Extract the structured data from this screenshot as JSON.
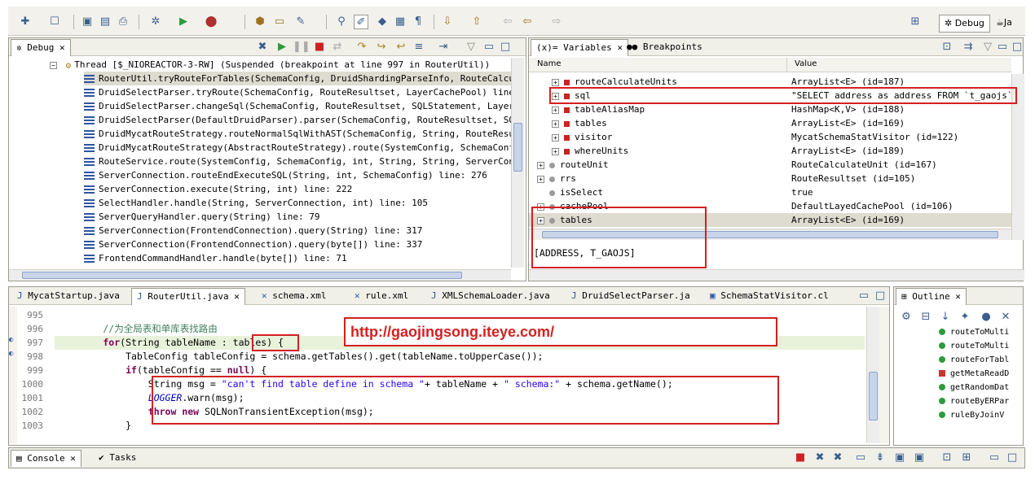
{
  "perspectives": {
    "debug": "Debug",
    "java": "Ja"
  },
  "debug_view": {
    "tab": "Debug",
    "thread": "Thread [$_NIOREACTOR-3-RW] (Suspended (breakpoint at line 997 in RouterUtil))",
    "frames": [
      "RouterUtil.tryRouteForTables(SchemaConfig, DruidShardingParseInfo, RouteCalculateUnit,",
      "DruidSelectParser.tryRoute(SchemaConfig, RouteResultset, LayerCachePool) line: 412",
      "DruidSelectParser.changeSql(SchemaConfig, RouteResultset, SQLStatement, LayerCachePool",
      "DruidSelectParser(DefaultDruidParser).parser(SchemaConfig, RouteResultset, SQLStatemen",
      "DruidMycatRouteStrategy.routeNormalSqlWithAST(SchemaConfig, String, RouteResultset, St",
      "DruidMycatRouteStrategy(AbstractRouteStrategy).route(SystemConfig, SchemaConfig, int,",
      "RouteService.route(SystemConfig, SchemaConfig, int, String, String, ServerConnection)",
      "ServerConnection.routeEndExecuteSQL(String, int, SchemaConfig) line: 276",
      "ServerConnection.execute(String, int) line: 222",
      "SelectHandler.handle(String, ServerConnection, int) line: 105",
      "ServerQueryHandler.query(String) line: 79",
      "ServerConnection(FrontendConnection).query(String) line: 317",
      "ServerConnection(FrontendConnection).query(byte[]) line: 337",
      "FrontendCommandHandler.handle(byte[]) line: 71"
    ]
  },
  "variables_view": {
    "tabs": [
      "Variables",
      "Breakpoints"
    ],
    "col_name": "Name",
    "col_value": "Value",
    "rows": [
      {
        "name": "routeCalculateUnits",
        "value": "ArrayList<E>  (id=187)",
        "kind": "field"
      },
      {
        "name": "sql",
        "value": "\"SELECT address as address  FROM `t_gaojs`\" (id",
        "kind": "field"
      },
      {
        "name": "tableAliasMap",
        "value": "HashMap<K,V>  (id=188)",
        "kind": "field"
      },
      {
        "name": "tables",
        "value": "ArrayList<E>  (id=169)",
        "kind": "field"
      },
      {
        "name": "visitor",
        "value": "MycatSchemaStatVisitor  (id=122)",
        "kind": "field"
      },
      {
        "name": "whereUnits",
        "value": "ArrayList<E>  (id=189)",
        "kind": "field"
      },
      {
        "name": "routeUnit",
        "value": "RouteCalculateUnit  (id=167)",
        "kind": "local"
      },
      {
        "name": "rrs",
        "value": "RouteResultset  (id=105)",
        "kind": "local"
      },
      {
        "name": "isSelect",
        "value": "true",
        "kind": "local"
      },
      {
        "name": "cachePool",
        "value": "DefaultLayedCachePool  (id=106)",
        "kind": "local"
      },
      {
        "name": "tables",
        "value": "ArrayList<E>  (id=169)",
        "kind": "local"
      }
    ],
    "detail": "[ADDRESS, T_GAOJS]"
  },
  "editor": {
    "tabs": [
      "MycatStartup.java",
      "RouterUtil.java",
      "schema.xml",
      "rule.xml",
      "XMLSchemaLoader.java",
      "DruidSelectParser.ja",
      "SchemaStatVisitor.cl"
    ],
    "lines": [
      {
        "n": "995",
        "parts": [
          [
            "",
            ""
          ]
        ]
      },
      {
        "n": "996",
        "parts": [
          [
            "cmt",
            "        //为全局表和单库表找路由"
          ]
        ]
      },
      {
        "n": "997",
        "parts": [
          [
            "kw",
            "        for"
          ],
          [
            "",
            "(String tableName : "
          ],
          [
            "",
            "tables"
          ],
          [
            "",
            ") {"
          ]
        ]
      },
      {
        "n": "998",
        "parts": [
          [
            "",
            "            TableConfig tableConfig = schema.getTables().get(tableName.toUpperCase());"
          ]
        ]
      },
      {
        "n": "999",
        "parts": [
          [
            "kw",
            "            if"
          ],
          [
            "",
            "(tableConfig == "
          ],
          [
            "kw",
            "null"
          ],
          [
            "",
            ") {"
          ]
        ]
      },
      {
        "n": "1000",
        "parts": [
          [
            "",
            "                String msg = "
          ],
          [
            "str",
            "\"can't find table define in schema \""
          ],
          [
            "",
            "+ tableName + "
          ],
          [
            "str",
            "\" schema:\""
          ],
          [
            "",
            " + schema.getName();"
          ]
        ]
      },
      {
        "n": "1001",
        "parts": [
          [
            "fld",
            "                LOGGER"
          ],
          [
            "",
            ".warn(msg);"
          ]
        ]
      },
      {
        "n": "1002",
        "parts": [
          [
            "kw",
            "                throw new"
          ],
          [
            "",
            " SQLNonTransientException(msg);"
          ]
        ]
      },
      {
        "n": "1003",
        "parts": [
          [
            "",
            "            }"
          ]
        ]
      }
    ],
    "annotation_url": "http://gaojingsong.iteye.com/"
  },
  "outline_view": {
    "tab": "Outline",
    "items": [
      {
        "label": "routeToMulti",
        "color": "green"
      },
      {
        "label": "routeToMulti",
        "color": "green"
      },
      {
        "label": "routeForTabl",
        "color": "green"
      },
      {
        "label": "getMetaReadD",
        "color": "red"
      },
      {
        "label": "getRandomDat",
        "color": "green"
      },
      {
        "label": "routeByERPar",
        "color": "green"
      },
      {
        "label": "ruleByJoinV",
        "color": "green"
      }
    ]
  },
  "bottom": {
    "tabs": [
      "Console",
      "Tasks"
    ]
  },
  "colors": {
    "accent": "#d42020",
    "bg": "#f0efe8",
    "selection": "#dedbd0"
  }
}
